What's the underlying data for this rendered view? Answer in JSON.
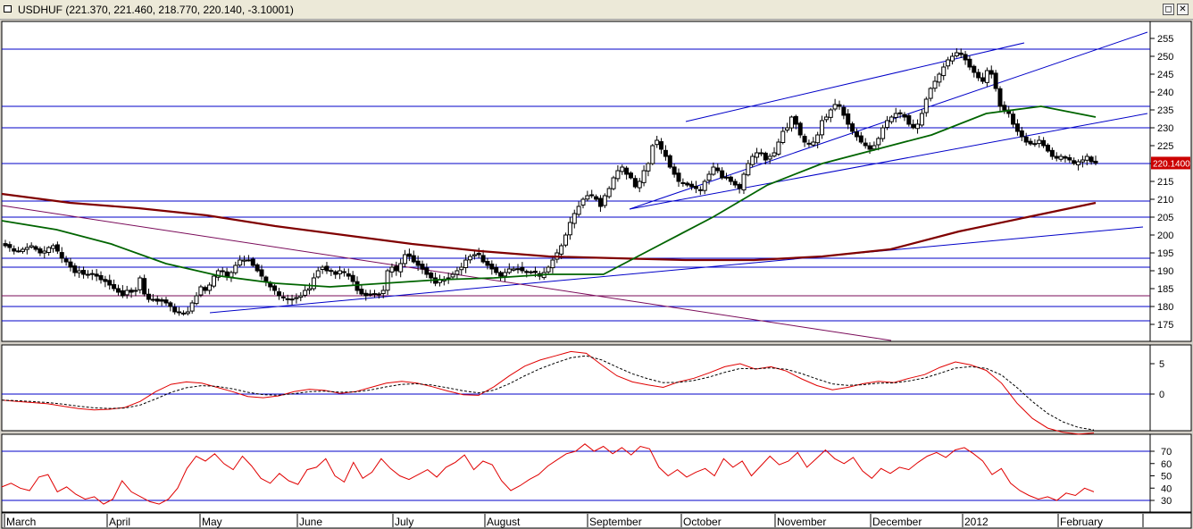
{
  "window": {
    "title": "USDHUF (221.370, 221.460, 218.770, 220.140, -3.10001)",
    "restore_glyph": "◻",
    "close_glyph": "✕"
  },
  "chart_data": [
    {
      "panel": "price",
      "type": "candlestick",
      "symbol": "USDHUF",
      "ohlc": {
        "open": 221.37,
        "high": 221.46,
        "low": 218.77,
        "close": 220.14,
        "change": -3.10001
      },
      "last_price_label": "220.1400",
      "ylim": [
        170,
        257
      ],
      "yticks": [
        175,
        180,
        185,
        190,
        195,
        200,
        205,
        210,
        215,
        220,
        225,
        230,
        235,
        240,
        245,
        250,
        255
      ],
      "month_labels": [
        "March",
        "April",
        "May",
        "June",
        "July",
        "August",
        "September",
        "October",
        "November",
        "December",
        "2012",
        "February"
      ],
      "closes": [
        197,
        196.5,
        195.5,
        195.5,
        196,
        196.5,
        197,
        196,
        195,
        195.5,
        196.5,
        197,
        195.5,
        193.5,
        192.5,
        191,
        189.5,
        190,
        189,
        189,
        189,
        188.5,
        187.5,
        187,
        186,
        185,
        184,
        183,
        184.5,
        184,
        184.5,
        188,
        183.5,
        182,
        182,
        181.5,
        181.5,
        181,
        180,
        178.5,
        178.5,
        178,
        178.5,
        181,
        183,
        185.5,
        184.5,
        186,
        188.5,
        190,
        190,
        188.5,
        189.5,
        191.5,
        193,
        193,
        193,
        191.5,
        190,
        188.5,
        187,
        185.5,
        184.5,
        183,
        182.5,
        182,
        182,
        182.5,
        183,
        184.5,
        185,
        188,
        190,
        191,
        190,
        190,
        189,
        190,
        189.5,
        188.5,
        187,
        184.5,
        183.5,
        183,
        183.5,
        183.5,
        183.5,
        184.5,
        190,
        191,
        190,
        192,
        194.5,
        194,
        192.5,
        191.5,
        190.5,
        189,
        188,
        186.5,
        187.5,
        187.5,
        188,
        189,
        190,
        191,
        193,
        194,
        194.5,
        194.5,
        192.5,
        191.5,
        190.5,
        189.5,
        188.5,
        189.5,
        190.5,
        190.5,
        190.5,
        190,
        189.5,
        189.5,
        189.5,
        188.5,
        189.5,
        191,
        193,
        195,
        197,
        200,
        203.5,
        206,
        208,
        210,
        211,
        211,
        210,
        208,
        211,
        213,
        216,
        218,
        219,
        217,
        216,
        213.5,
        215,
        218,
        220,
        225,
        226.5,
        224,
        222,
        219,
        217,
        215,
        214.5,
        214,
        213.5,
        213,
        212.5,
        215,
        217,
        219,
        218,
        216,
        216,
        215,
        214,
        213,
        217,
        220,
        222,
        223,
        223,
        221,
        222,
        223,
        226,
        229,
        230,
        233,
        231,
        228,
        226,
        225.5,
        226,
        228,
        232,
        233,
        235,
        236.5,
        236,
        233.5,
        231,
        229,
        227.5,
        226,
        225,
        224,
        225,
        227,
        230,
        232,
        233,
        234,
        234,
        233,
        231,
        230,
        231,
        234,
        238,
        241,
        243,
        245,
        247,
        249,
        250,
        251,
        250.5,
        249,
        247,
        245.5,
        244,
        243,
        246,
        245,
        241,
        236,
        235,
        234,
        231,
        229,
        227.5,
        226,
        225.5,
        225.5,
        226.5,
        225,
        223.5,
        222,
        221.5,
        222,
        221.5,
        221,
        220,
        220.5,
        221,
        222,
        220.5,
        220.14
      ],
      "moving_averages": [
        {
          "length": "long",
          "color": "#800000",
          "values": [
            211.5,
            209,
            207.5,
            205.5,
            202.5,
            200,
            197.5,
            195.5,
            194,
            193.5,
            193,
            193,
            194,
            196,
            201,
            205,
            209
          ]
        },
        {
          "length": "medium",
          "color": "#006400",
          "values": [
            204,
            201.5,
            197.5,
            192,
            188.5,
            186.5,
            185.5,
            186.5,
            187.5,
            188,
            189,
            189,
            197,
            205,
            214,
            220,
            224,
            228,
            234,
            236,
            233
          ]
        }
      ],
      "horizontal_levels": [
        252,
        236,
        230,
        220,
        209.5,
        205,
        193.5,
        191,
        183,
        180,
        176
      ],
      "level_colors": {
        "blue": "#0000c8",
        "purple": "#7a0b5a"
      }
    },
    {
      "panel": "macd",
      "type": "line",
      "yticks": [
        5,
        0
      ],
      "ylim": [
        -8,
        8.5
      ],
      "series_colors": {
        "main": "#e00000",
        "signal": "#000000"
      },
      "values": [
        -1,
        -1.2,
        -1.4,
        -1.6,
        -2,
        -2.4,
        -2.6,
        -2.5,
        -2.2,
        -1.2,
        0.4,
        1.6,
        2,
        1.8,
        1.1,
        0.4,
        -0.4,
        -0.6,
        -0.3,
        0.4,
        0.8,
        0.6,
        0.1,
        0.4,
        1.1,
        1.8,
        2.1,
        1.8,
        1.2,
        0.5,
        -0.1,
        -0.2,
        1.2,
        3,
        4.6,
        5.6,
        6.3,
        7,
        6.7,
        4.8,
        3,
        2,
        1.5,
        1.1,
        2,
        2.6,
        3.5,
        4.5,
        5,
        4.1,
        4.5,
        3.8,
        2.5,
        1.4,
        0.7,
        1.1,
        1.7,
        2.1,
        1.9,
        2.6,
        3.2,
        4.4,
        5.3,
        4.8,
        3.9,
        1.8,
        -1.5,
        -4,
        -5.6,
        -6.3,
        -6.6,
        -6.4
      ]
    },
    {
      "panel": "rsi",
      "type": "line",
      "yticks": [
        70,
        60,
        50,
        40,
        30
      ],
      "levels": [
        70,
        30
      ],
      "ylim": [
        26,
        80
      ],
      "values": [
        41,
        44,
        40,
        38,
        49,
        51,
        37,
        41,
        35,
        31,
        33,
        27,
        31,
        46,
        37,
        33,
        29,
        27,
        31,
        40,
        56,
        66,
        62,
        68,
        60,
        55,
        66,
        58,
        48,
        44,
        52,
        46,
        43,
        55,
        57,
        64,
        50,
        45,
        61,
        48,
        53,
        64,
        56,
        50,
        47,
        51,
        55,
        49,
        57,
        61,
        67,
        55,
        62,
        59,
        46,
        38,
        42,
        47,
        51,
        58,
        63,
        68,
        70,
        76,
        70,
        74,
        68,
        73,
        67,
        74,
        72,
        57,
        50,
        55,
        49,
        53,
        56,
        50,
        64,
        57,
        62,
        50,
        58,
        66,
        59,
        62,
        69,
        57,
        64,
        71,
        64,
        60,
        65,
        54,
        48,
        56,
        52,
        57,
        55,
        61,
        66,
        69,
        65,
        71,
        73,
        68,
        62,
        51,
        56,
        44,
        38,
        34,
        31,
        33,
        30,
        36,
        34,
        40,
        37
      ]
    }
  ]
}
